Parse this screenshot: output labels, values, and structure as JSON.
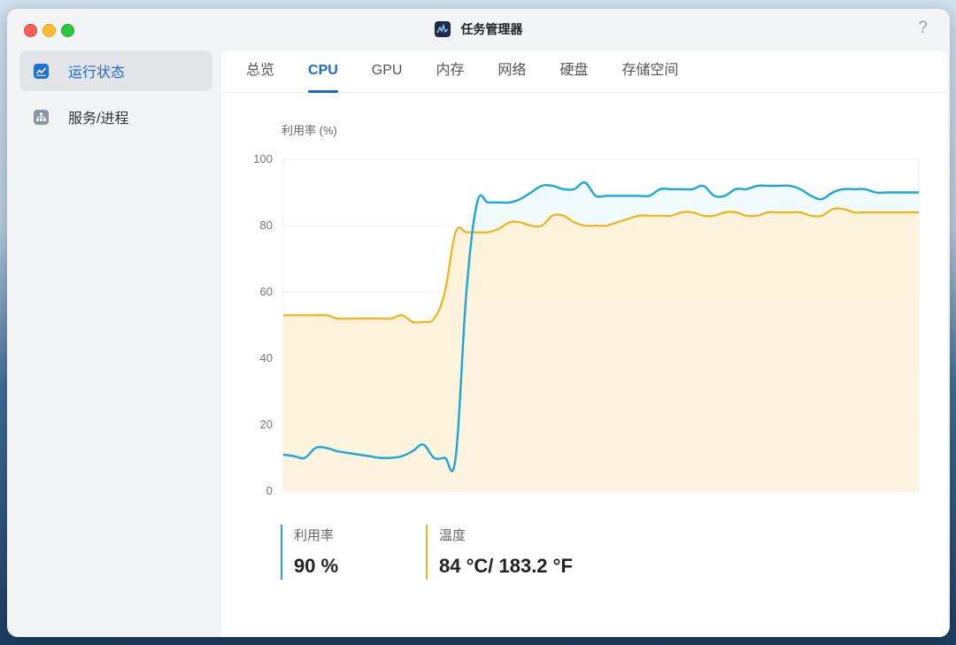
{
  "window": {
    "title": "任务管理器",
    "help": "?"
  },
  "sidebar": {
    "items": [
      {
        "label": "运行状态",
        "icon": "chart-icon",
        "active": true
      },
      {
        "label": "服务/进程",
        "icon": "hierarchy-icon",
        "active": false
      }
    ]
  },
  "tabs": [
    {
      "label": "总览",
      "active": false
    },
    {
      "label": "CPU",
      "active": true
    },
    {
      "label": "GPU",
      "active": false
    },
    {
      "label": "内存",
      "active": false
    },
    {
      "label": "网络",
      "active": false
    },
    {
      "label": "硬盘",
      "active": false
    },
    {
      "label": "存储空间",
      "active": false
    }
  ],
  "chart_data": {
    "type": "area",
    "title": "",
    "ylabel": "利用率 (%)",
    "xlabel": "",
    "ylim": [
      0,
      100
    ],
    "y_ticks": [
      "0",
      "20",
      "40",
      "60",
      "80",
      "100"
    ],
    "grid": true,
    "colors": {
      "usage": "#1ba6dd",
      "temperature": "#f0b31b"
    },
    "x": [
      0,
      1,
      2,
      3,
      4,
      5,
      6,
      7,
      8,
      9,
      10,
      11,
      12,
      13,
      14,
      15,
      16,
      17,
      18,
      19,
      20,
      21,
      22,
      23,
      24,
      25,
      26,
      27,
      28,
      29,
      30,
      31,
      32,
      33,
      34,
      35,
      36,
      37,
      38,
      39,
      40,
      41,
      42,
      43,
      44,
      45,
      46,
      47,
      48,
      49,
      50,
      51,
      52,
      53,
      54,
      55,
      56,
      57,
      58,
      59
    ],
    "series": [
      {
        "name": "利用率",
        "values": [
          11,
          10.5,
          10,
          13,
          13,
          12,
          11.5,
          11,
          10.5,
          10,
          10,
          10.5,
          12,
          14,
          10,
          10,
          10,
          60,
          87,
          87,
          87,
          87,
          88,
          90,
          92,
          92,
          91,
          91,
          93,
          89,
          89,
          89,
          89,
          89,
          89,
          91,
          91,
          91,
          91,
          92,
          89,
          89,
          91,
          91,
          92,
          92,
          92,
          92,
          91,
          89,
          88,
          90,
          91,
          91,
          91,
          90,
          90,
          90,
          90,
          90
        ]
      },
      {
        "name": "温度",
        "values": [
          53,
          53,
          53,
          53,
          53,
          52,
          52,
          52,
          52,
          52,
          52,
          53,
          51,
          51,
          52,
          60,
          78,
          78,
          78,
          78,
          79,
          81,
          81,
          80,
          80,
          83,
          83,
          81,
          80,
          80,
          80,
          81,
          82,
          83,
          83,
          83,
          83,
          84,
          84,
          83,
          83,
          84,
          84,
          83,
          83,
          84,
          84,
          84,
          84,
          83,
          83,
          85,
          85,
          84,
          84,
          84,
          84,
          84,
          84,
          84
        ]
      }
    ]
  },
  "stats": [
    {
      "label": "利用率",
      "value": "90 %"
    },
    {
      "label": "温度",
      "value": "84 °C/ 183.2 °F"
    }
  ]
}
